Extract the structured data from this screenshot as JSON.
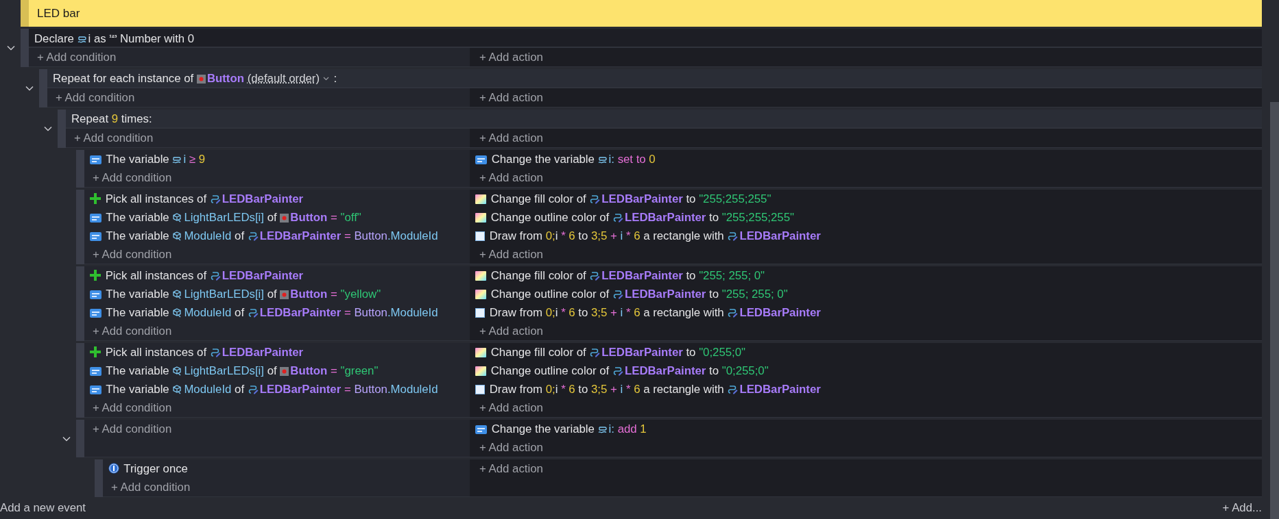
{
  "group": {
    "title": "LED bar"
  },
  "events": [
    {
      "kind": "standard",
      "expanded": true,
      "variables": [
        {
          "kind": "text",
          "text": "Declare"
        },
        {
          "kind": "declared_var",
          "text": "i"
        },
        {
          "kind": "text",
          "text": "as"
        },
        {
          "kind": "typeglyph",
          "text": "¹²³"
        },
        {
          "kind": "text",
          "text": "Number with 0"
        }
      ],
      "add_condition": "+ Add condition",
      "add_action": "+ Add action",
      "children": [
        {
          "kind": "for_each",
          "expanded": true,
          "header": [
            {
              "kind": "text",
              "text": "Repeat for each instance of"
            },
            {
              "kind": "sprite",
              "text": "Button"
            },
            {
              "kind": "option",
              "text": "(default order)"
            },
            {
              "kind": "text",
              "text": ":"
            }
          ],
          "add_condition": "+ Add condition",
          "add_action": "+ Add action",
          "children": [
            {
              "kind": "repeat",
              "expanded": true,
              "header": [
                {
                  "kind": "text",
                  "text": "Repeat"
                },
                {
                  "kind": "num",
                  "text": "9"
                },
                {
                  "kind": "text",
                  "text": "times:"
                }
              ],
              "add_condition": "+ Add condition",
              "add_action": "+ Add action",
              "children": [
                {
                  "kind": "standard",
                  "conditions": [
                    {
                      "kind": "variable",
                      "parts": [
                        {
                          "kind": "text",
                          "text": "The variable"
                        },
                        {
                          "kind": "scene_var",
                          "text": "i"
                        },
                        {
                          "kind": "op",
                          "text": "≥"
                        },
                        {
                          "kind": "num",
                          "text": "9"
                        }
                      ]
                    }
                  ],
                  "add_condition": "+ Add condition",
                  "actions": [
                    {
                      "kind": "variable",
                      "parts": [
                        {
                          "kind": "text",
                          "text": "Change the variable"
                        },
                        {
                          "kind": "scene_var",
                          "text": "i"
                        },
                        {
                          "kind": "suffix",
                          "text": ":"
                        },
                        {
                          "kind": "op",
                          "text": "set to"
                        },
                        {
                          "kind": "num",
                          "text": "0"
                        }
                      ]
                    }
                  ],
                  "add_action": "+ Add action"
                },
                {
                  "kind": "standard",
                  "conditions": [
                    {
                      "kind": "pick",
                      "parts": [
                        {
                          "kind": "text",
                          "text": "Pick all instances of"
                        },
                        {
                          "kind": "painter",
                          "text": "LEDBarPainter"
                        }
                      ]
                    },
                    {
                      "kind": "variable",
                      "parts": [
                        {
                          "kind": "text",
                          "text": "The variable"
                        },
                        {
                          "kind": "object_var",
                          "text": "LightBarLEDs[i]"
                        },
                        {
                          "kind": "text",
                          "text": "of"
                        },
                        {
                          "kind": "sprite",
                          "text": "Button"
                        },
                        {
                          "kind": "op",
                          "text": "="
                        },
                        {
                          "kind": "str",
                          "text": "\"off\""
                        }
                      ]
                    },
                    {
                      "kind": "variable",
                      "parts": [
                        {
                          "kind": "text",
                          "text": "The variable"
                        },
                        {
                          "kind": "object_var",
                          "text": "ModuleId"
                        },
                        {
                          "kind": "text",
                          "text": "of"
                        },
                        {
                          "kind": "painter",
                          "text": "LEDBarPainter"
                        },
                        {
                          "kind": "op",
                          "text": "="
                        },
                        {
                          "kind": "exprobj",
                          "text": "Button"
                        },
                        {
                          "kind": "member",
                          "text": ".ModuleId"
                        }
                      ]
                    }
                  ],
                  "add_condition": "+ Add condition",
                  "actions": [
                    {
                      "kind": "color",
                      "parts": [
                        {
                          "kind": "text",
                          "text": "Change fill color of"
                        },
                        {
                          "kind": "painter",
                          "text": "LEDBarPainter"
                        },
                        {
                          "kind": "text",
                          "text": "to"
                        },
                        {
                          "kind": "str",
                          "text": "\"255;255;255\""
                        }
                      ]
                    },
                    {
                      "kind": "color",
                      "parts": [
                        {
                          "kind": "text",
                          "text": "Change outline color of"
                        },
                        {
                          "kind": "painter",
                          "text": "LEDBarPainter"
                        },
                        {
                          "kind": "text",
                          "text": "to"
                        },
                        {
                          "kind": "str",
                          "text": "\"255;255;255\""
                        }
                      ]
                    },
                    {
                      "kind": "draw",
                      "parts": [
                        {
                          "kind": "text",
                          "text": "Draw from"
                        },
                        {
                          "kind": "num",
                          "text": "0;"
                        },
                        {
                          "kind": "expr_attached",
                          "text": "i"
                        },
                        {
                          "kind": "op",
                          "text": "*"
                        },
                        {
                          "kind": "num",
                          "text": "6"
                        },
                        {
                          "kind": "text",
                          "text": "to"
                        },
                        {
                          "kind": "num",
                          "text": "3;5"
                        },
                        {
                          "kind": "op",
                          "text": "+"
                        },
                        {
                          "kind": "var",
                          "text": "i"
                        },
                        {
                          "kind": "op",
                          "text": "*"
                        },
                        {
                          "kind": "num",
                          "text": "6"
                        },
                        {
                          "kind": "text",
                          "text": "a rectangle with"
                        },
                        {
                          "kind": "painter",
                          "text": "LEDBarPainter"
                        }
                      ]
                    }
                  ],
                  "add_action": "+ Add action"
                },
                {
                  "kind": "standard",
                  "conditions": [
                    {
                      "kind": "pick",
                      "parts": [
                        {
                          "kind": "text",
                          "text": "Pick all instances of"
                        },
                        {
                          "kind": "painter",
                          "text": "LEDBarPainter"
                        }
                      ]
                    },
                    {
                      "kind": "variable",
                      "parts": [
                        {
                          "kind": "text",
                          "text": "The variable"
                        },
                        {
                          "kind": "object_var",
                          "text": "LightBarLEDs[i]"
                        },
                        {
                          "kind": "text",
                          "text": "of"
                        },
                        {
                          "kind": "sprite",
                          "text": "Button"
                        },
                        {
                          "kind": "op",
                          "text": "="
                        },
                        {
                          "kind": "str",
                          "text": "\"yellow\""
                        }
                      ]
                    },
                    {
                      "kind": "variable",
                      "parts": [
                        {
                          "kind": "text",
                          "text": "The variable"
                        },
                        {
                          "kind": "object_var",
                          "text": "ModuleId"
                        },
                        {
                          "kind": "text",
                          "text": "of"
                        },
                        {
                          "kind": "painter",
                          "text": "LEDBarPainter"
                        },
                        {
                          "kind": "op",
                          "text": "="
                        },
                        {
                          "kind": "exprobj",
                          "text": "Button"
                        },
                        {
                          "kind": "member",
                          "text": ".ModuleId"
                        }
                      ]
                    }
                  ],
                  "add_condition": "+ Add condition",
                  "actions": [
                    {
                      "kind": "color",
                      "parts": [
                        {
                          "kind": "text",
                          "text": "Change fill color of"
                        },
                        {
                          "kind": "painter",
                          "text": "LEDBarPainter"
                        },
                        {
                          "kind": "text",
                          "text": "to"
                        },
                        {
                          "kind": "str",
                          "text": "\"255; 255; 0\""
                        }
                      ]
                    },
                    {
                      "kind": "color",
                      "parts": [
                        {
                          "kind": "text",
                          "text": "Change outline color of"
                        },
                        {
                          "kind": "painter",
                          "text": "LEDBarPainter"
                        },
                        {
                          "kind": "text",
                          "text": "to"
                        },
                        {
                          "kind": "str",
                          "text": "\"255; 255; 0\""
                        }
                      ]
                    },
                    {
                      "kind": "draw",
                      "parts": [
                        {
                          "kind": "text",
                          "text": "Draw from"
                        },
                        {
                          "kind": "num",
                          "text": "0;"
                        },
                        {
                          "kind": "expr_attached",
                          "text": "i"
                        },
                        {
                          "kind": "op",
                          "text": "*"
                        },
                        {
                          "kind": "num",
                          "text": "6"
                        },
                        {
                          "kind": "text",
                          "text": "to"
                        },
                        {
                          "kind": "num",
                          "text": "3;5"
                        },
                        {
                          "kind": "op",
                          "text": "+"
                        },
                        {
                          "kind": "var",
                          "text": "i"
                        },
                        {
                          "kind": "op",
                          "text": "*"
                        },
                        {
                          "kind": "num",
                          "text": "6"
                        },
                        {
                          "kind": "text",
                          "text": "a rectangle with"
                        },
                        {
                          "kind": "painter",
                          "text": "LEDBarPainter"
                        }
                      ]
                    }
                  ],
                  "add_action": "+ Add action"
                },
                {
                  "kind": "standard",
                  "conditions": [
                    {
                      "kind": "pick",
                      "parts": [
                        {
                          "kind": "text",
                          "text": "Pick all instances of"
                        },
                        {
                          "kind": "painter",
                          "text": "LEDBarPainter"
                        }
                      ]
                    },
                    {
                      "kind": "variable",
                      "parts": [
                        {
                          "kind": "text",
                          "text": "The variable"
                        },
                        {
                          "kind": "object_var",
                          "text": "LightBarLEDs[i]"
                        },
                        {
                          "kind": "text",
                          "text": "of"
                        },
                        {
                          "kind": "sprite",
                          "text": "Button"
                        },
                        {
                          "kind": "op",
                          "text": "="
                        },
                        {
                          "kind": "str",
                          "text": "\"green\""
                        }
                      ]
                    },
                    {
                      "kind": "variable",
                      "parts": [
                        {
                          "kind": "text",
                          "text": "The variable"
                        },
                        {
                          "kind": "object_var",
                          "text": "ModuleId"
                        },
                        {
                          "kind": "text",
                          "text": "of"
                        },
                        {
                          "kind": "painter",
                          "text": "LEDBarPainter"
                        },
                        {
                          "kind": "op",
                          "text": "="
                        },
                        {
                          "kind": "exprobj",
                          "text": "Button"
                        },
                        {
                          "kind": "member",
                          "text": ".ModuleId"
                        }
                      ]
                    }
                  ],
                  "add_condition": "+ Add condition",
                  "actions": [
                    {
                      "kind": "color",
                      "parts": [
                        {
                          "kind": "text",
                          "text": "Change fill color of"
                        },
                        {
                          "kind": "painter",
                          "text": "LEDBarPainter"
                        },
                        {
                          "kind": "text",
                          "text": "to"
                        },
                        {
                          "kind": "str",
                          "text": "\"0;255;0\""
                        }
                      ]
                    },
                    {
                      "kind": "color",
                      "parts": [
                        {
                          "kind": "text",
                          "text": "Change outline color of"
                        },
                        {
                          "kind": "painter",
                          "text": "LEDBarPainter"
                        },
                        {
                          "kind": "text",
                          "text": "to"
                        },
                        {
                          "kind": "str",
                          "text": "\"0;255;0\""
                        }
                      ]
                    },
                    {
                      "kind": "draw",
                      "parts": [
                        {
                          "kind": "text",
                          "text": "Draw from"
                        },
                        {
                          "kind": "num",
                          "text": "0;"
                        },
                        {
                          "kind": "expr_attached",
                          "text": "i"
                        },
                        {
                          "kind": "op",
                          "text": "*"
                        },
                        {
                          "kind": "num",
                          "text": "6"
                        },
                        {
                          "kind": "text",
                          "text": "to"
                        },
                        {
                          "kind": "num",
                          "text": "3;5"
                        },
                        {
                          "kind": "op",
                          "text": "+"
                        },
                        {
                          "kind": "var",
                          "text": "i"
                        },
                        {
                          "kind": "op",
                          "text": "*"
                        },
                        {
                          "kind": "num",
                          "text": "6"
                        },
                        {
                          "kind": "text",
                          "text": "a rectangle with"
                        },
                        {
                          "kind": "painter",
                          "text": "LEDBarPainter"
                        }
                      ]
                    }
                  ],
                  "add_action": "+ Add action"
                },
                {
                  "kind": "standard",
                  "expanded": true,
                  "add_condition": "+ Add condition",
                  "actions": [
                    {
                      "kind": "variable",
                      "parts": [
                        {
                          "kind": "text",
                          "text": "Change the variable"
                        },
                        {
                          "kind": "scene_var",
                          "text": "i"
                        },
                        {
                          "kind": "suffix",
                          "text": ":"
                        },
                        {
                          "kind": "op",
                          "text": "add"
                        },
                        {
                          "kind": "num",
                          "text": "1"
                        }
                      ]
                    }
                  ],
                  "add_action": "+ Add action",
                  "children": [
                    {
                      "kind": "standard",
                      "conditions": [
                        {
                          "kind": "trigger",
                          "parts": [
                            {
                              "kind": "text",
                              "text": "Trigger once"
                            }
                          ]
                        }
                      ],
                      "add_condition": "+ Add condition",
                      "add_action": "+ Add action"
                    }
                  ]
                }
              ]
            }
          ]
        }
      ]
    }
  ],
  "footer": {
    "add_event": "Add a new event",
    "add_other": "+ Add..."
  }
}
